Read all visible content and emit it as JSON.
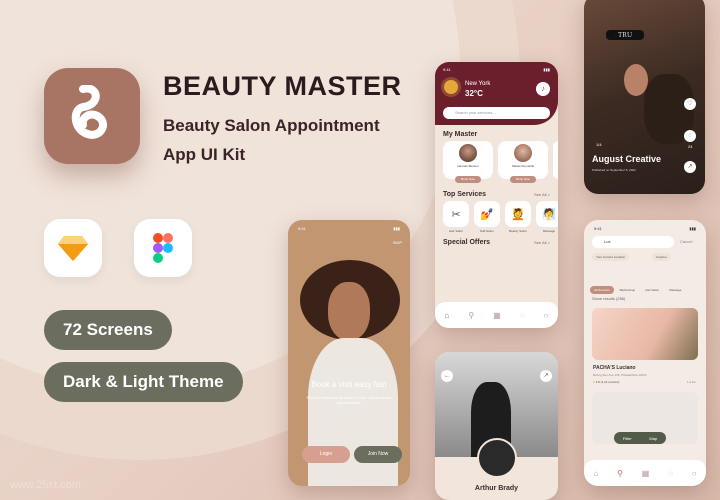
{
  "brand": {
    "title": "BEAUTY MASTER",
    "subtitle_line1": "Beauty Salon Appointment",
    "subtitle_line2": "App UI Kit",
    "logo_letter": "B",
    "logo_color": "#a87464"
  },
  "tools": [
    {
      "name": "sketch-icon"
    },
    {
      "name": "figma-icon"
    }
  ],
  "badges": {
    "screens": "72 Screens",
    "theme": "Dark & Light Theme",
    "color": "#6b6d5e"
  },
  "watermark": "www.25xt.com",
  "home_screen": {
    "time": "9:41",
    "city": "New York",
    "temperature": "32°C",
    "search_placeholder": "Search your services...",
    "my_master": {
      "title": "My Master",
      "items": [
        {
          "name": "Hannah Benson",
          "button": "Book Now"
        },
        {
          "name": "Maisie Reynolds",
          "button": "Book Now"
        }
      ]
    },
    "top_services": {
      "title": "Top Services",
      "see_all": "See All >",
      "items": [
        {
          "label": "Hair Salon",
          "icon": "✂"
        },
        {
          "label": "Nail Salon",
          "icon": "💅"
        },
        {
          "label": "Beauty Salon",
          "icon": "💆"
        },
        {
          "label": "Massage",
          "icon": "🧖"
        }
      ]
    },
    "special_offers": {
      "title": "Special Offers",
      "see_all": "See All >"
    },
    "nav": [
      "home-icon",
      "search-icon",
      "calendar-icon",
      "chat-icon",
      "profile-icon"
    ],
    "header_color": "#6b1f2d"
  },
  "feed_screen": {
    "counter": "1/4",
    "title": "August Creative",
    "subtitle": "Published on September 5, 2022",
    "likes": "12k",
    "comments": "24",
    "razor_text": "TRU"
  },
  "onboarding_screen": {
    "time": "9:41",
    "skip": "SKIP",
    "headline": "Book a visit easy fast",
    "body": "Find the best beauty salon in your city and book appointments.",
    "login": "Login",
    "join": "Join Now"
  },
  "profile_screen": {
    "name": "Arthur Brady"
  },
  "search_screen": {
    "time": "9:41",
    "query": "Lux",
    "cancel": "Cancel",
    "location": "Your Current Location",
    "time_filter": "Anytime",
    "chips": [
      "All Services",
      "Barbershop",
      "Hair Salon",
      "Massage"
    ],
    "results": "Show results (256)",
    "result_title": "PACHA'S Luciano",
    "result_address": "Boring Sun Ave 145, Philadelphia 19115",
    "rating": "4.8",
    "reviews": "(1.2k reviews)",
    "distance": "1.2 km",
    "filter": "Filter",
    "map": "Map"
  }
}
